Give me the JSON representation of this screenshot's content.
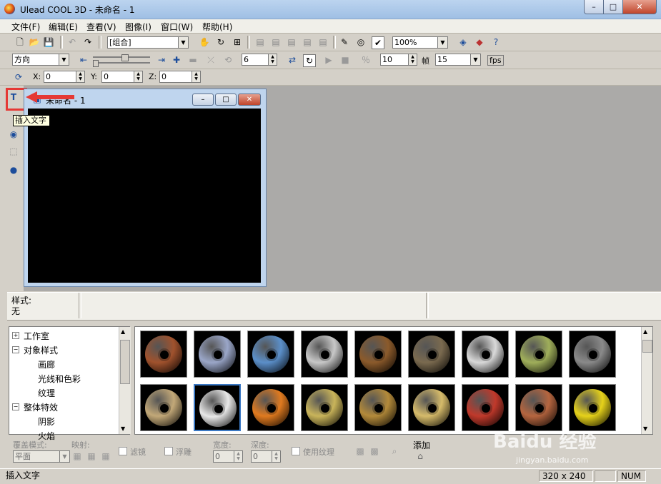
{
  "window": {
    "title": "Ulead COOL 3D - 未命名 - 1",
    "min": "–",
    "max": "□",
    "close": "✕"
  },
  "menu": [
    {
      "label": "文件(F)"
    },
    {
      "label": "编辑(E)"
    },
    {
      "label": "查看(V)"
    },
    {
      "label": "图像(I)"
    },
    {
      "label": "窗口(W)"
    },
    {
      "label": "帮助(H)"
    }
  ],
  "toolbar1": {
    "object_select": "[组合]",
    "zoom": "100%"
  },
  "toolbar2": {
    "direction_select": "方向",
    "frame_field": "6",
    "frames_value": "10",
    "frame_label": "帧",
    "fps_value": "15",
    "fps_label": "fps"
  },
  "toolbar3": {
    "x_label": "X:",
    "x_value": "0",
    "y_label": "Y:",
    "y_value": "0",
    "z_label": "Z:",
    "z_value": "0"
  },
  "tooltip": "插入文字",
  "document": {
    "title": "未命名 - 1"
  },
  "style_panel": {
    "label": "样式:",
    "value": "无"
  },
  "tree": [
    {
      "label": "工作室",
      "level": 0,
      "expander": "+"
    },
    {
      "label": "对象样式",
      "level": 0,
      "expander": "−"
    },
    {
      "label": "画廊",
      "level": 1
    },
    {
      "label": "光线和色彩",
      "level": 1
    },
    {
      "label": "纹理",
      "level": 1
    },
    {
      "label": "整体特效",
      "level": 0,
      "expander": "−"
    },
    {
      "label": "阴影",
      "level": 1
    },
    {
      "label": "火焰",
      "level": 1
    }
  ],
  "textures": [
    {
      "name": "brick",
      "color": "#a0522d",
      "selected": false
    },
    {
      "name": "blue-marble",
      "color": "#9aa6c8",
      "selected": false
    },
    {
      "name": "blue-stone",
      "color": "#5b8fc9",
      "selected": false
    },
    {
      "name": "stone-block",
      "color": "#c8c8c8",
      "selected": false
    },
    {
      "name": "wood-grain",
      "color": "#8b5a2b",
      "selected": false
    },
    {
      "name": "rock",
      "color": "#7a6a4f",
      "selected": false
    },
    {
      "name": "crumpled-paper",
      "color": "#d9d9d9",
      "selected": false
    },
    {
      "name": "green-moss",
      "color": "#9fae5a",
      "selected": false
    },
    {
      "name": "granite",
      "color": "#8a8a8a",
      "selected": false
    },
    {
      "name": "burlap",
      "color": "#c2a878",
      "selected": false
    },
    {
      "name": "chrome",
      "color": "#e8e8e8",
      "selected": true
    },
    {
      "name": "orange",
      "color": "#e07a1f",
      "selected": false
    },
    {
      "name": "gold",
      "color": "#c9b45a",
      "selected": false
    },
    {
      "name": "bronze",
      "color": "#b38a3a",
      "selected": false
    },
    {
      "name": "gold-shiny",
      "color": "#d6bb6a",
      "selected": false
    },
    {
      "name": "red-brick",
      "color": "#c0392b",
      "selected": false
    },
    {
      "name": "clay-brick",
      "color": "#b5653f",
      "selected": false
    },
    {
      "name": "yellow",
      "color": "#e6d21a",
      "selected": false
    }
  ],
  "properties": {
    "cover_mode_label": "覆盖模式:",
    "cover_mode_value": "平面",
    "mapping_label": "映射:",
    "filter_label": "滤镜",
    "emboss_label": "浮雕",
    "width_label": "宽度:",
    "width_value": "0",
    "depth_label": "深度:",
    "depth_value": "0",
    "use_texture_label": "使用纹理",
    "add_label": "添加"
  },
  "status": {
    "message": "插入文字",
    "size": "320 x 240",
    "num": "NUM"
  },
  "watermark": {
    "brand": "Baidu 经验",
    "url": "jingyan.baidu.com"
  }
}
